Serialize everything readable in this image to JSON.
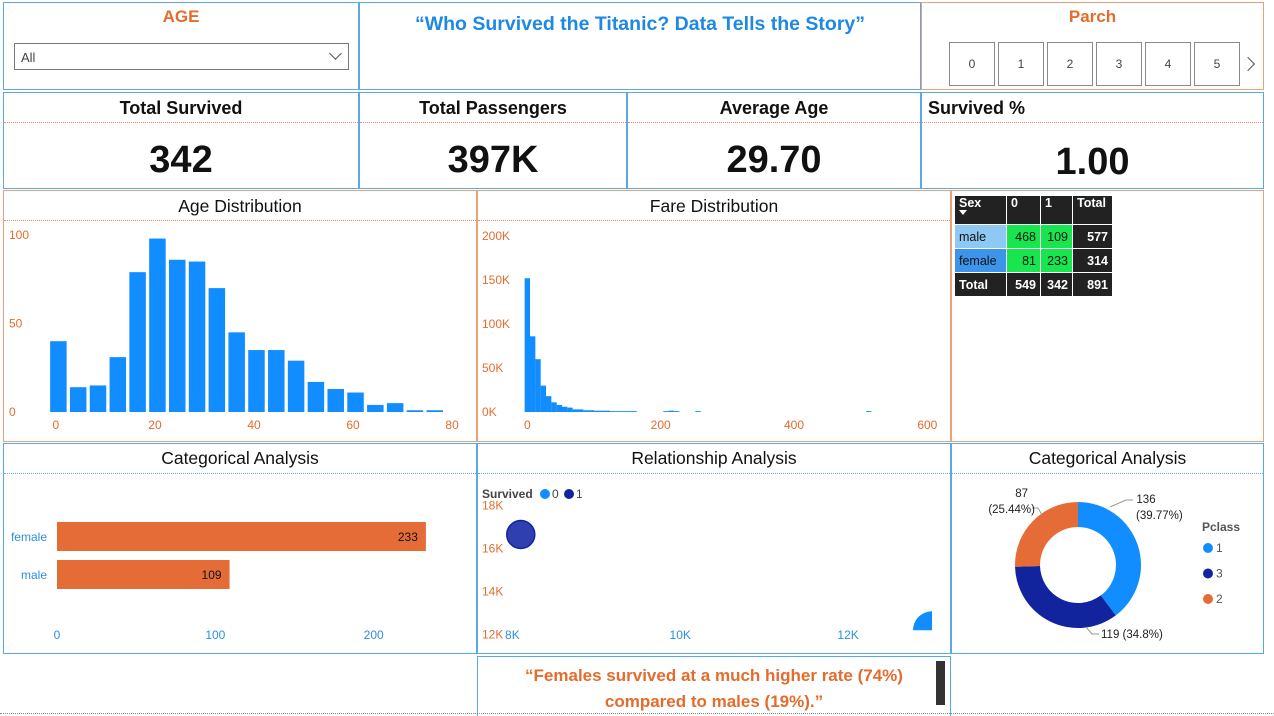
{
  "title": "“Who Survived the Titanic? Data Tells the Story”",
  "age_filter": {
    "label": "AGE",
    "selected": "All"
  },
  "parch_filter": {
    "label": "Parch",
    "buttons": [
      "0",
      "1",
      "2",
      "3",
      "4",
      "5"
    ]
  },
  "kpis": [
    {
      "label": "Total Survived",
      "value": "342"
    },
    {
      "label": "Total Passengers",
      "value": "397K"
    },
    {
      "label": "Average Age",
      "value": "29.70"
    },
    {
      "label": "Survived %",
      "value": "1.00"
    }
  ],
  "matrix": {
    "headers": [
      "Sex",
      "0",
      "1",
      "Total"
    ],
    "rows": [
      {
        "sex": "male",
        "c0": "468",
        "c1": "109",
        "total": "577"
      },
      {
        "sex": "female",
        "c0": "81",
        "c1": "233",
        "total": "314"
      }
    ],
    "total_row": {
      "label": "Total",
      "c0": "549",
      "c1": "342",
      "total": "891"
    }
  },
  "quote_line1": "“Females survived at a much higher rate (74%)",
  "quote_line2": "compared to males (19%).”",
  "colors": {
    "blue": "#118dff",
    "navy": "#12239e",
    "orange": "#e66c37",
    "label_orange": "#e46c2e",
    "axis_blue": "#2b8fe0"
  },
  "chart_data": [
    {
      "id": "age",
      "type": "bar",
      "title": "Age Distribution",
      "x": [
        0.5,
        4.5,
        8.5,
        12.5,
        16.5,
        20.5,
        24.5,
        28.5,
        32.5,
        36.5,
        40.5,
        44.5,
        48.5,
        52.5,
        56.5,
        60.5,
        64.5,
        68.5,
        72.5,
        76.5
      ],
      "values": [
        40,
        14,
        15,
        31,
        79,
        98,
        86,
        85,
        70,
        45,
        35,
        35,
        29,
        17,
        13,
        11,
        4,
        5,
        1,
        1
      ],
      "xlim": [
        -2,
        82
      ],
      "ylim": [
        0,
        100
      ],
      "xticks": [
        0,
        20,
        40,
        60,
        80
      ],
      "yticks": [
        0,
        50,
        100
      ],
      "ytick_labels": [
        "0",
        "50",
        "100"
      ]
    },
    {
      "id": "fare",
      "type": "bar",
      "title": "Fare Distribution",
      "x": [
        0,
        8,
        16,
        24,
        32,
        40,
        48,
        56,
        64,
        72,
        80,
        88,
        96,
        104,
        112,
        120,
        128,
        136,
        144,
        152,
        160,
        208,
        216,
        224,
        256,
        512
      ],
      "values": [
        152000,
        86000,
        60000,
        30000,
        18000,
        11000,
        8000,
        6000,
        5000,
        3000,
        3000,
        2000,
        2000,
        1500,
        1500,
        1500,
        1000,
        1000,
        1000,
        1000,
        1000,
        1000,
        1500,
        1000,
        1000,
        1000
      ],
      "xlim": [
        -5,
        610
      ],
      "ylim": [
        0,
        200000
      ],
      "xticks": [
        0,
        200,
        400,
        600
      ],
      "yticks": [
        0,
        50000,
        100000,
        150000,
        200000
      ],
      "ytick_labels": [
        "0K",
        "50K",
        "100K",
        "150K",
        "200K"
      ]
    },
    {
      "id": "sex",
      "type": "bar",
      "orientation": "horizontal",
      "title": "Categorical Analysis",
      "categories": [
        "female",
        "male"
      ],
      "values": [
        233,
        109
      ],
      "xlim": [
        0,
        240
      ],
      "xticks": [
        0,
        100,
        200
      ]
    },
    {
      "id": "relationship",
      "type": "scatter",
      "title": "Relationship Analysis",
      "legend_title": "Survived",
      "series": [
        {
          "name": "0",
          "color": "#118dff",
          "points": [
            {
              "x": 13000,
              "y": 12200
            }
          ]
        },
        {
          "name": "1",
          "color": "#12239e",
          "points": [
            {
              "x": 8100,
              "y": 16650
            }
          ]
        }
      ],
      "xlim": [
        7900,
        13000
      ],
      "ylim": [
        11700,
        18300
      ],
      "xticks": [
        8000,
        10000,
        12000
      ],
      "xtick_labels": [
        "8K",
        "10K",
        "12K"
      ],
      "yticks": [
        12000,
        14000,
        16000,
        18000
      ],
      "ytick_labels": [
        "12K",
        "14K",
        "16K",
        "18K"
      ]
    },
    {
      "id": "pclass",
      "type": "pie",
      "title": "Categorical Analysis",
      "legend_title": "Pclass",
      "slices": [
        {
          "name": "1",
          "value": 136,
          "label": "136 (39.77%)",
          "color": "#118dff"
        },
        {
          "name": "3",
          "value": 119,
          "label": "119 (34.8%)",
          "color": "#12239e"
        },
        {
          "name": "2",
          "value": 87,
          "label": "87 (25.44%)",
          "color": "#e66c37"
        }
      ]
    }
  ]
}
